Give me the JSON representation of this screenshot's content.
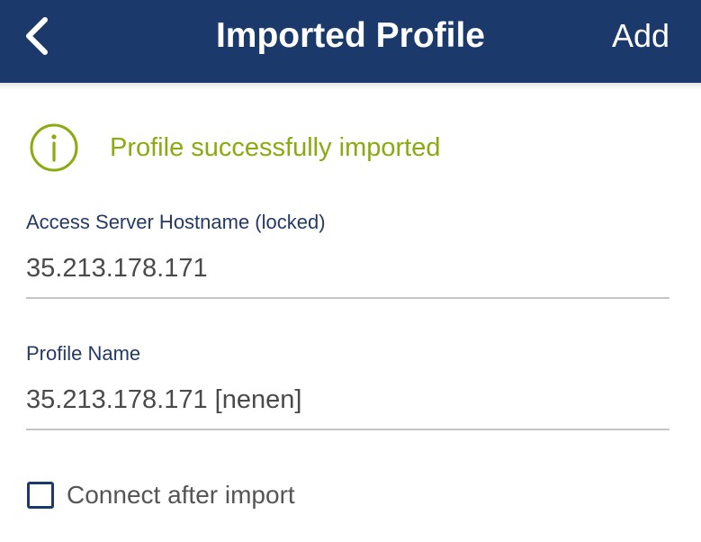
{
  "header": {
    "title": "Imported Profile",
    "add_label": "Add",
    "background": "#1b3a6b",
    "back_icon": "chevron-left-icon"
  },
  "notice": {
    "icon": "info-circle-icon",
    "text": "Profile successfully imported",
    "color": "#8aab0f"
  },
  "fields": [
    {
      "label": "Access Server Hostname (locked)",
      "value": "35.213.178.171"
    },
    {
      "label": "Profile Name",
      "value": "35.213.178.171 [nenen]"
    }
  ],
  "connect_option": {
    "label": "Connect after import",
    "checked": false
  }
}
